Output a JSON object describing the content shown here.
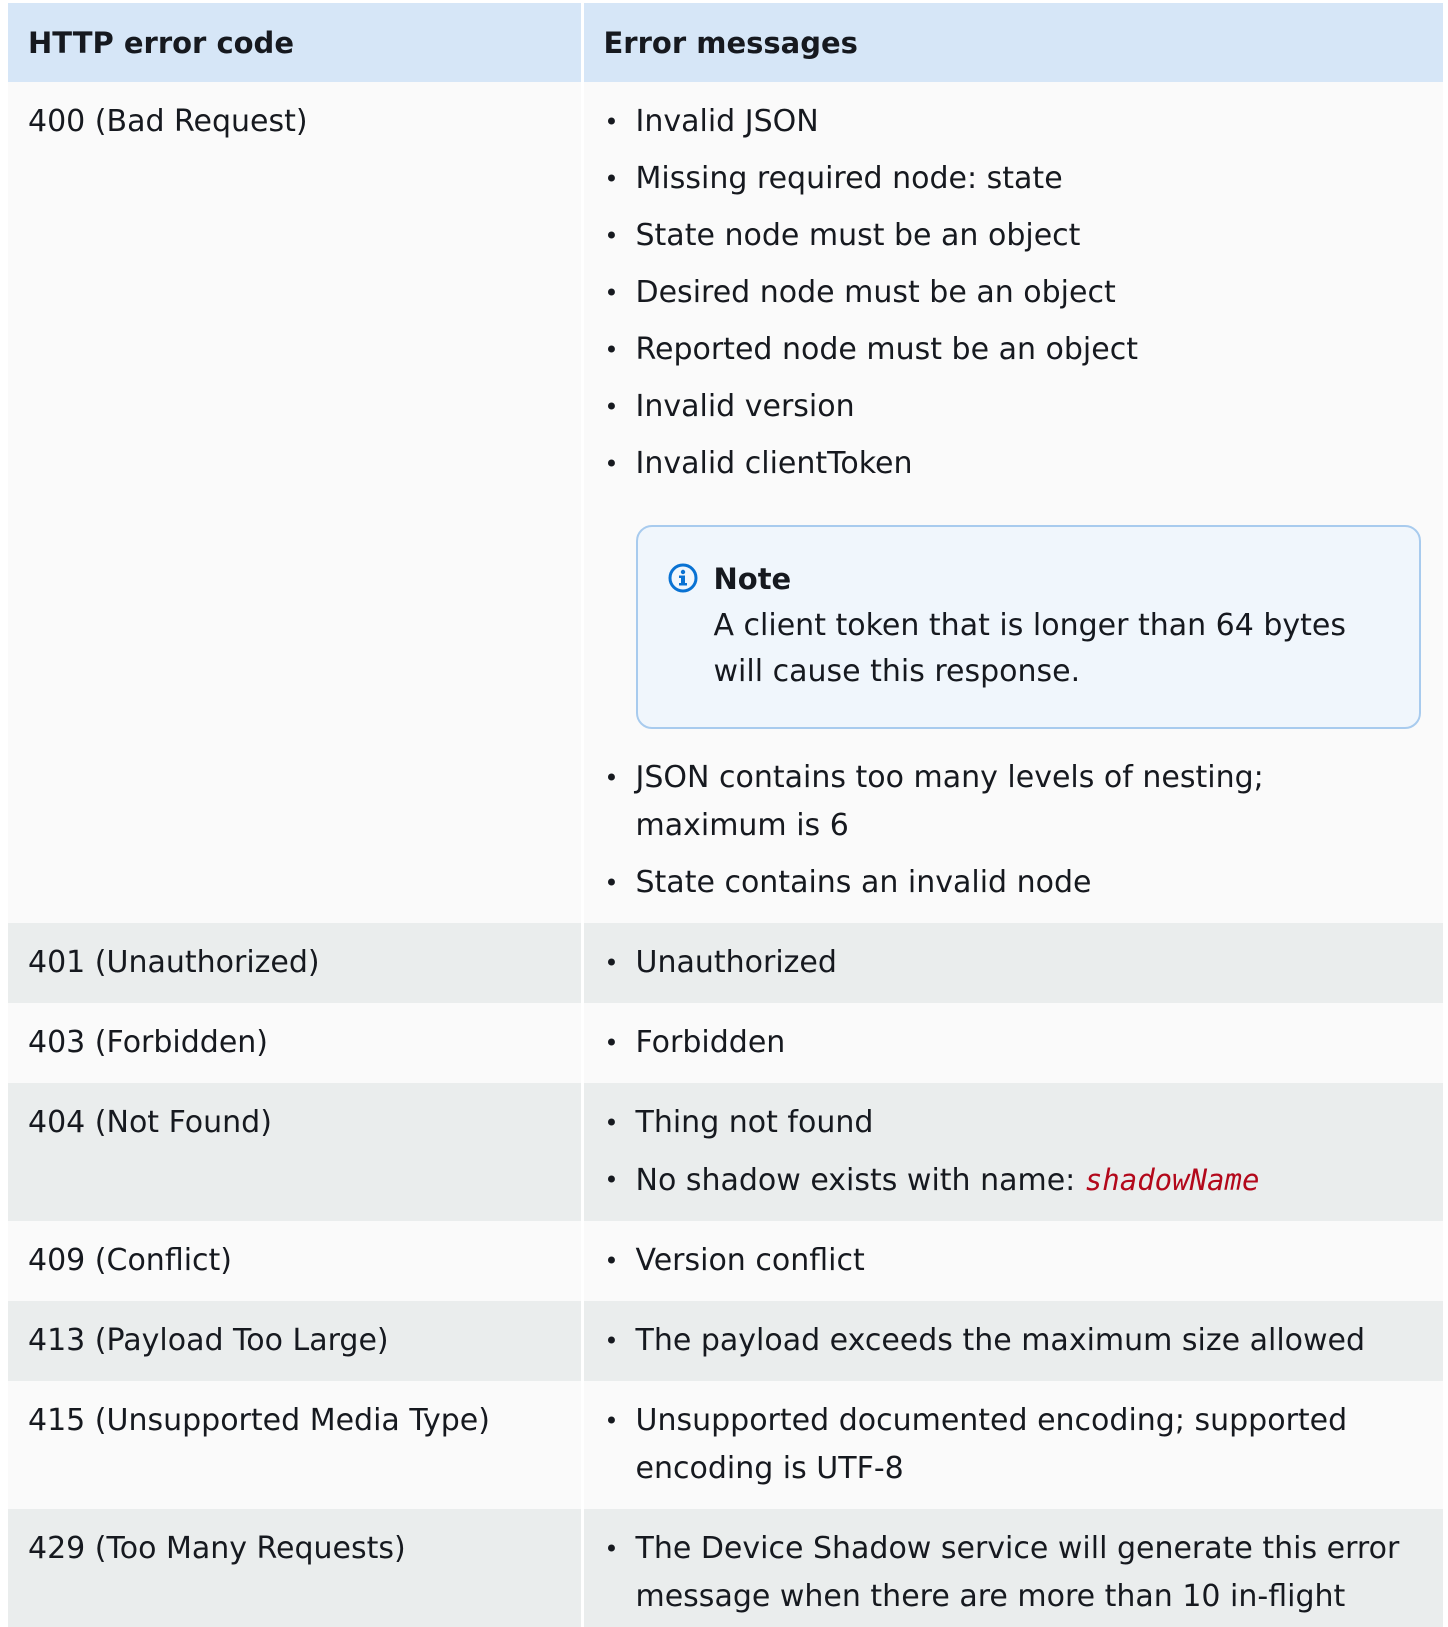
{
  "table": {
    "headers": [
      "HTTP error code",
      "Error messages"
    ],
    "rows": [
      {
        "code": "400 (Bad Request)",
        "messages_before_note": [
          "Invalid JSON",
          "Missing required node: state",
          "State node must be an object",
          "Desired node must be an object",
          "Reported node must be an object",
          "Invalid version",
          "Invalid clientToken"
        ],
        "note": {
          "title": "Note",
          "body": "A client token that is longer than 64 bytes will cause this response.",
          "icon": "info-circle-icon",
          "icon_color": "#0972d3"
        },
        "messages_after_note": [
          "JSON contains too many levels of nesting; maximum is 6",
          "State contains an invalid node"
        ]
      },
      {
        "code": "401 (Unauthorized)",
        "messages": [
          "Unauthorized"
        ]
      },
      {
        "code": "403 (Forbidden)",
        "messages": [
          "Forbidden"
        ]
      },
      {
        "code": "404 (Not Found)",
        "messages": [
          "Thing not found"
        ],
        "shadow_message": {
          "prefix": "No shadow exists with name: ",
          "variable": "shadowName"
        }
      },
      {
        "code": "409 (Conflict)",
        "messages": [
          "Version conflict"
        ]
      },
      {
        "code": "413 (Payload Too Large)",
        "messages": [
          "The payload exceeds the maximum size allowed"
        ]
      },
      {
        "code": "415 (Unsupported Media Type)",
        "messages": [
          "Unsupported documented encoding; supported encoding is UTF-8"
        ]
      },
      {
        "code": "429 (Too Many Requests)",
        "messages": [
          "The Device Shadow service will generate this error message when there are more than 10 in-flight"
        ]
      }
    ]
  },
  "colors": {
    "header_bg": "#d6e6f7",
    "row_light": "#fafafa",
    "row_shaded": "#eaeded",
    "variable_text": "#b3081b",
    "note_border": "#a8cbee",
    "note_bg": "#f0f6fc"
  }
}
